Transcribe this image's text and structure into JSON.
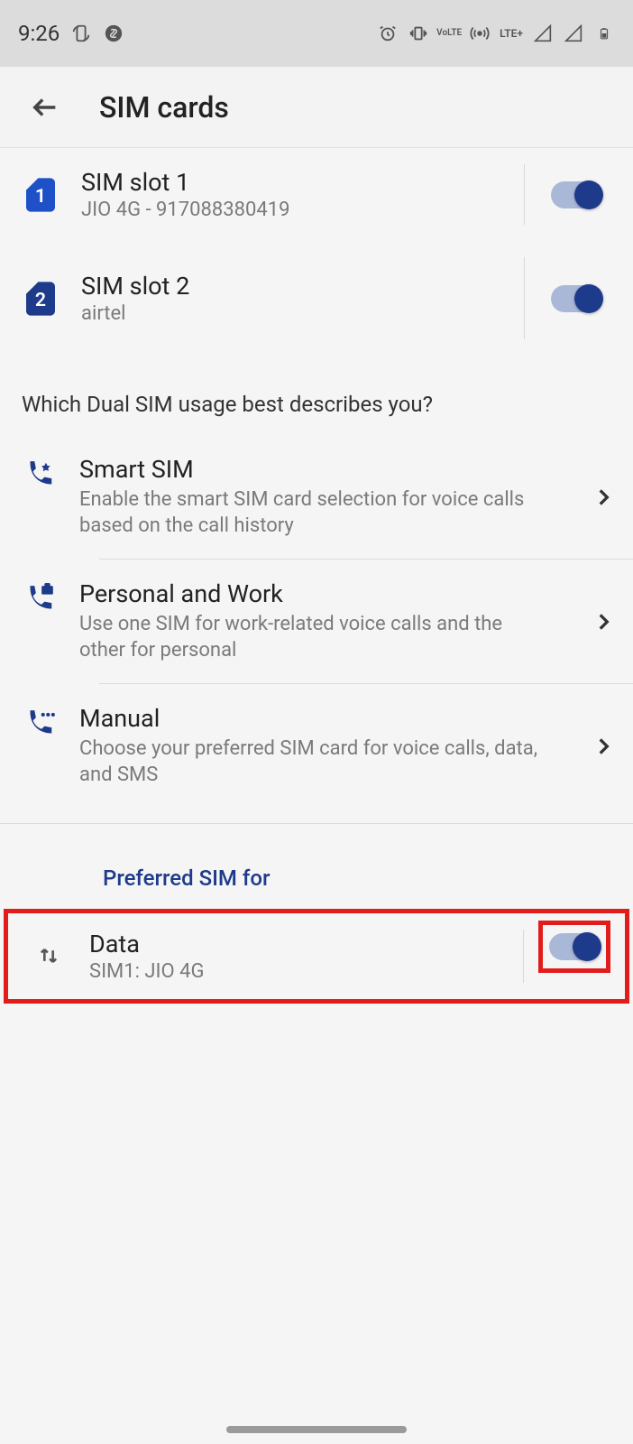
{
  "status": {
    "time": "9:26",
    "lte_label": "LTE+",
    "volte_label": "LTE"
  },
  "header": {
    "title": "SIM cards"
  },
  "sim_slots": [
    {
      "title": "SIM slot 1",
      "subtitle": "JIO 4G - 917088380419",
      "num": "1"
    },
    {
      "title": "SIM slot 2",
      "subtitle": "airtel",
      "num": "2"
    }
  ],
  "section_question": "Which Dual SIM usage best describes you?",
  "usage": [
    {
      "title": "Smart SIM",
      "subtitle": "Enable the smart SIM card selection for voice calls based on the call history"
    },
    {
      "title": "Personal and Work",
      "subtitle": "Use one SIM for work-related voice calls and the other for personal"
    },
    {
      "title": "Manual",
      "subtitle": "Choose your preferred SIM card for voice calls, data, and SMS"
    }
  ],
  "preferred_header": "Preferred SIM for",
  "data_row": {
    "title": "Data",
    "subtitle": "SIM1: JIO 4G"
  }
}
